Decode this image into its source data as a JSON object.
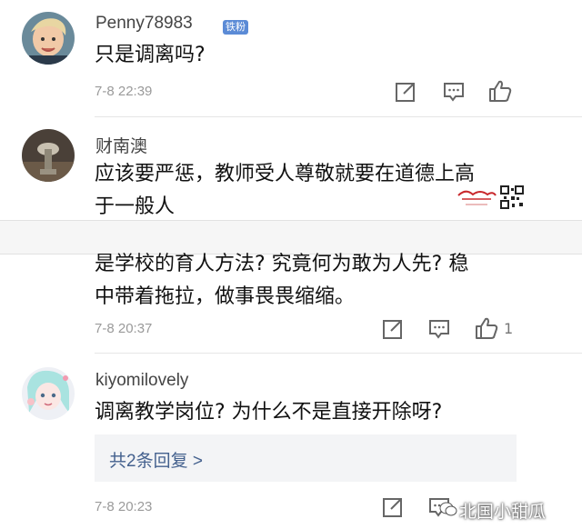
{
  "comments": [
    {
      "username": "Penny78983",
      "badge": "铁粉",
      "text_lines": [
        "只是调离吗?"
      ],
      "time": "7-8 22:39"
    },
    {
      "username": "财南澳",
      "text_lines": [
        "应该要严惩，教师受人尊敬就要在道德上高",
        "于一般人"
      ]
    },
    {
      "text_lines": [
        "是学校的育人方法? 究竟何为敢为人先? 稳",
        "中带着拖拉，做事畏畏缩缩。"
      ],
      "time": "7-8 20:37",
      "like_count": "1"
    },
    {
      "username": "kiyomilovely",
      "text_lines": [
        "调离教学岗位? 为什么不是直接开除呀?"
      ],
      "reply_label": "共2条回复 >",
      "time": "7-8 20:23"
    }
  ],
  "watermark": {
    "text": "北国小甜瓜"
  },
  "icons": {
    "share": "share-icon",
    "comment": "comment-icon",
    "like": "thumbs-up-icon"
  },
  "colors": {
    "badge": "#5b8bd6",
    "reply_text": "#44618e",
    "time": "#9a9a9a"
  }
}
